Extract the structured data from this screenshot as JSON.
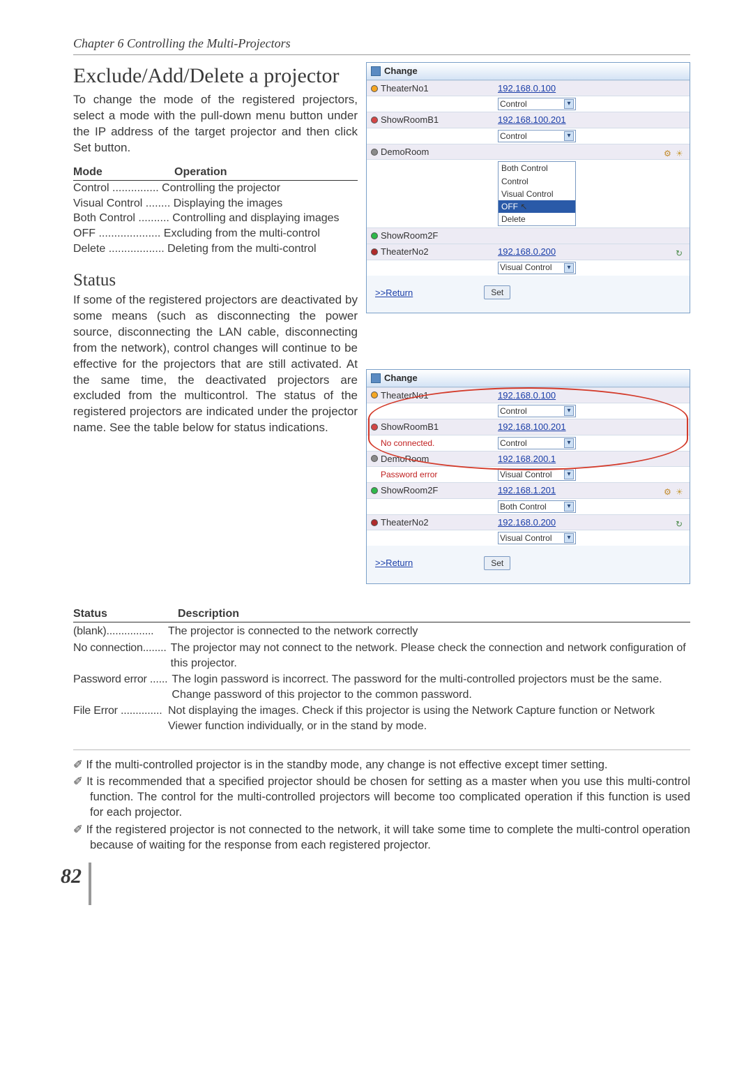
{
  "chapter": "Chapter 6 Controlling the Multi-Projectors",
  "title1": "Exclude/Add/Delete a projector",
  "para1": "To change the mode of the registered projectors, select a mode with the pull-down menu button under the IP address of the target projector and then click Set button.",
  "modeTable": {
    "h1": "Mode",
    "h2": "Operation",
    "rows": [
      {
        "m": "Control",
        "dots": " ............... ",
        "d": "Controlling the projector"
      },
      {
        "m": "Visual Control",
        "dots": " ........ ",
        "d": "Displaying the images"
      },
      {
        "m": "Both Control",
        "dots": " .......... ",
        "d": "Controlling and displaying images"
      },
      {
        "m": "OFF",
        "dots": " .................... ",
        "d": "Excluding from the multi-control"
      },
      {
        "m": "Delete",
        "dots": " .................. ",
        "d": "Deleting from the multi-control"
      }
    ]
  },
  "title2": "Status",
  "para2": "If some of the registered projectors are deactivated by some means (such as disconnecting the power source, disconnecting the LAN cable, disconnecting from the network), control changes will continue to be effective for the projectors that are still activated. At the same time, the deactivated projectors are excluded from the multicontrol. The status of the registered projectors are indicated under the projector name. See the table below for status indications.",
  "statusTable": {
    "h1": "Status",
    "h2": "Description",
    "rows": [
      {
        "s": "(blank)",
        "dots": "................",
        "d": "The projector is connected to the network correctly"
      },
      {
        "s": "No connection",
        "dots": "........",
        "d": "The projector may not connect to the network. Please check the connection and network configuration of this projector."
      },
      {
        "s": "Password error",
        "dots": " ......",
        "d": "The login password is incorrect. The password for the multi-controlled projectors must be the same. Change password of this projector to the common password."
      },
      {
        "s": "File Error",
        "dots": " ..............",
        "d": " Not displaying the images. Check if this projector is using the Network Capture function or Network Viewer function individually, or  in the stand by mode."
      }
    ]
  },
  "notes": [
    "If the multi-controlled projector is in the standby mode, any change is not effective except timer setting.",
    "It is recommended that a specified projector should be chosen for setting as a master when you use this multi-control function. The control for the multi-controlled projectors will become too complicated operation if this function is used for each projector.",
    "If the registered projector is not connected to the network, it will take some time to complete the multi-control operation because of waiting for the response from each registered projector."
  ],
  "pageNum": "82",
  "win1": {
    "title": "Change",
    "rows": [
      {
        "led": "orange",
        "name": "TheaterNo1",
        "ip": "192.168.0.100",
        "sel": "Control"
      },
      {
        "led": "red",
        "name": "ShowRoomB1",
        "ip": "192.168.100.201",
        "sel": "Control"
      },
      {
        "led": "gray",
        "name": "DemoRoom",
        "ip": "",
        "open": true,
        "opts": [
          "Both Control",
          "Control",
          "Visual Control",
          "OFF",
          "Delete"
        ],
        "hl": "OFF",
        "icons": [
          "gear",
          "ghost"
        ]
      },
      {
        "led": "green",
        "name": "ShowRoom2F",
        "skip": true
      },
      {
        "led": "dred",
        "name": "TheaterNo2",
        "ip": "192.168.0.200",
        "sel": "Visual Control",
        "icons": [
          "refresh"
        ]
      }
    ],
    "return": ">>Return",
    "set": "Set"
  },
  "win2": {
    "title": "Change",
    "rows": [
      {
        "led": "orange",
        "name": "TheaterNo1",
        "ip": "192.168.0.100",
        "sel": "Control"
      },
      {
        "led": "red",
        "name": "ShowRoomB1",
        "err": "No connected.",
        "ip": "192.168.100.201",
        "sel": "Control"
      },
      {
        "led": "gray",
        "name": "DemoRoom",
        "err": "Password error",
        "ip": "192.168.200.1",
        "sel": "Visual Control"
      },
      {
        "led": "green",
        "name": "ShowRoom2F",
        "ip": "192.168.1.201",
        "sel": "Both Control",
        "icons": [
          "gear",
          "ghost"
        ]
      },
      {
        "led": "dred",
        "name": "TheaterNo2",
        "ip": "192.168.0.200",
        "sel": "Visual Control",
        "icons": [
          "refresh"
        ]
      }
    ],
    "return": ">>Return",
    "set": "Set"
  }
}
